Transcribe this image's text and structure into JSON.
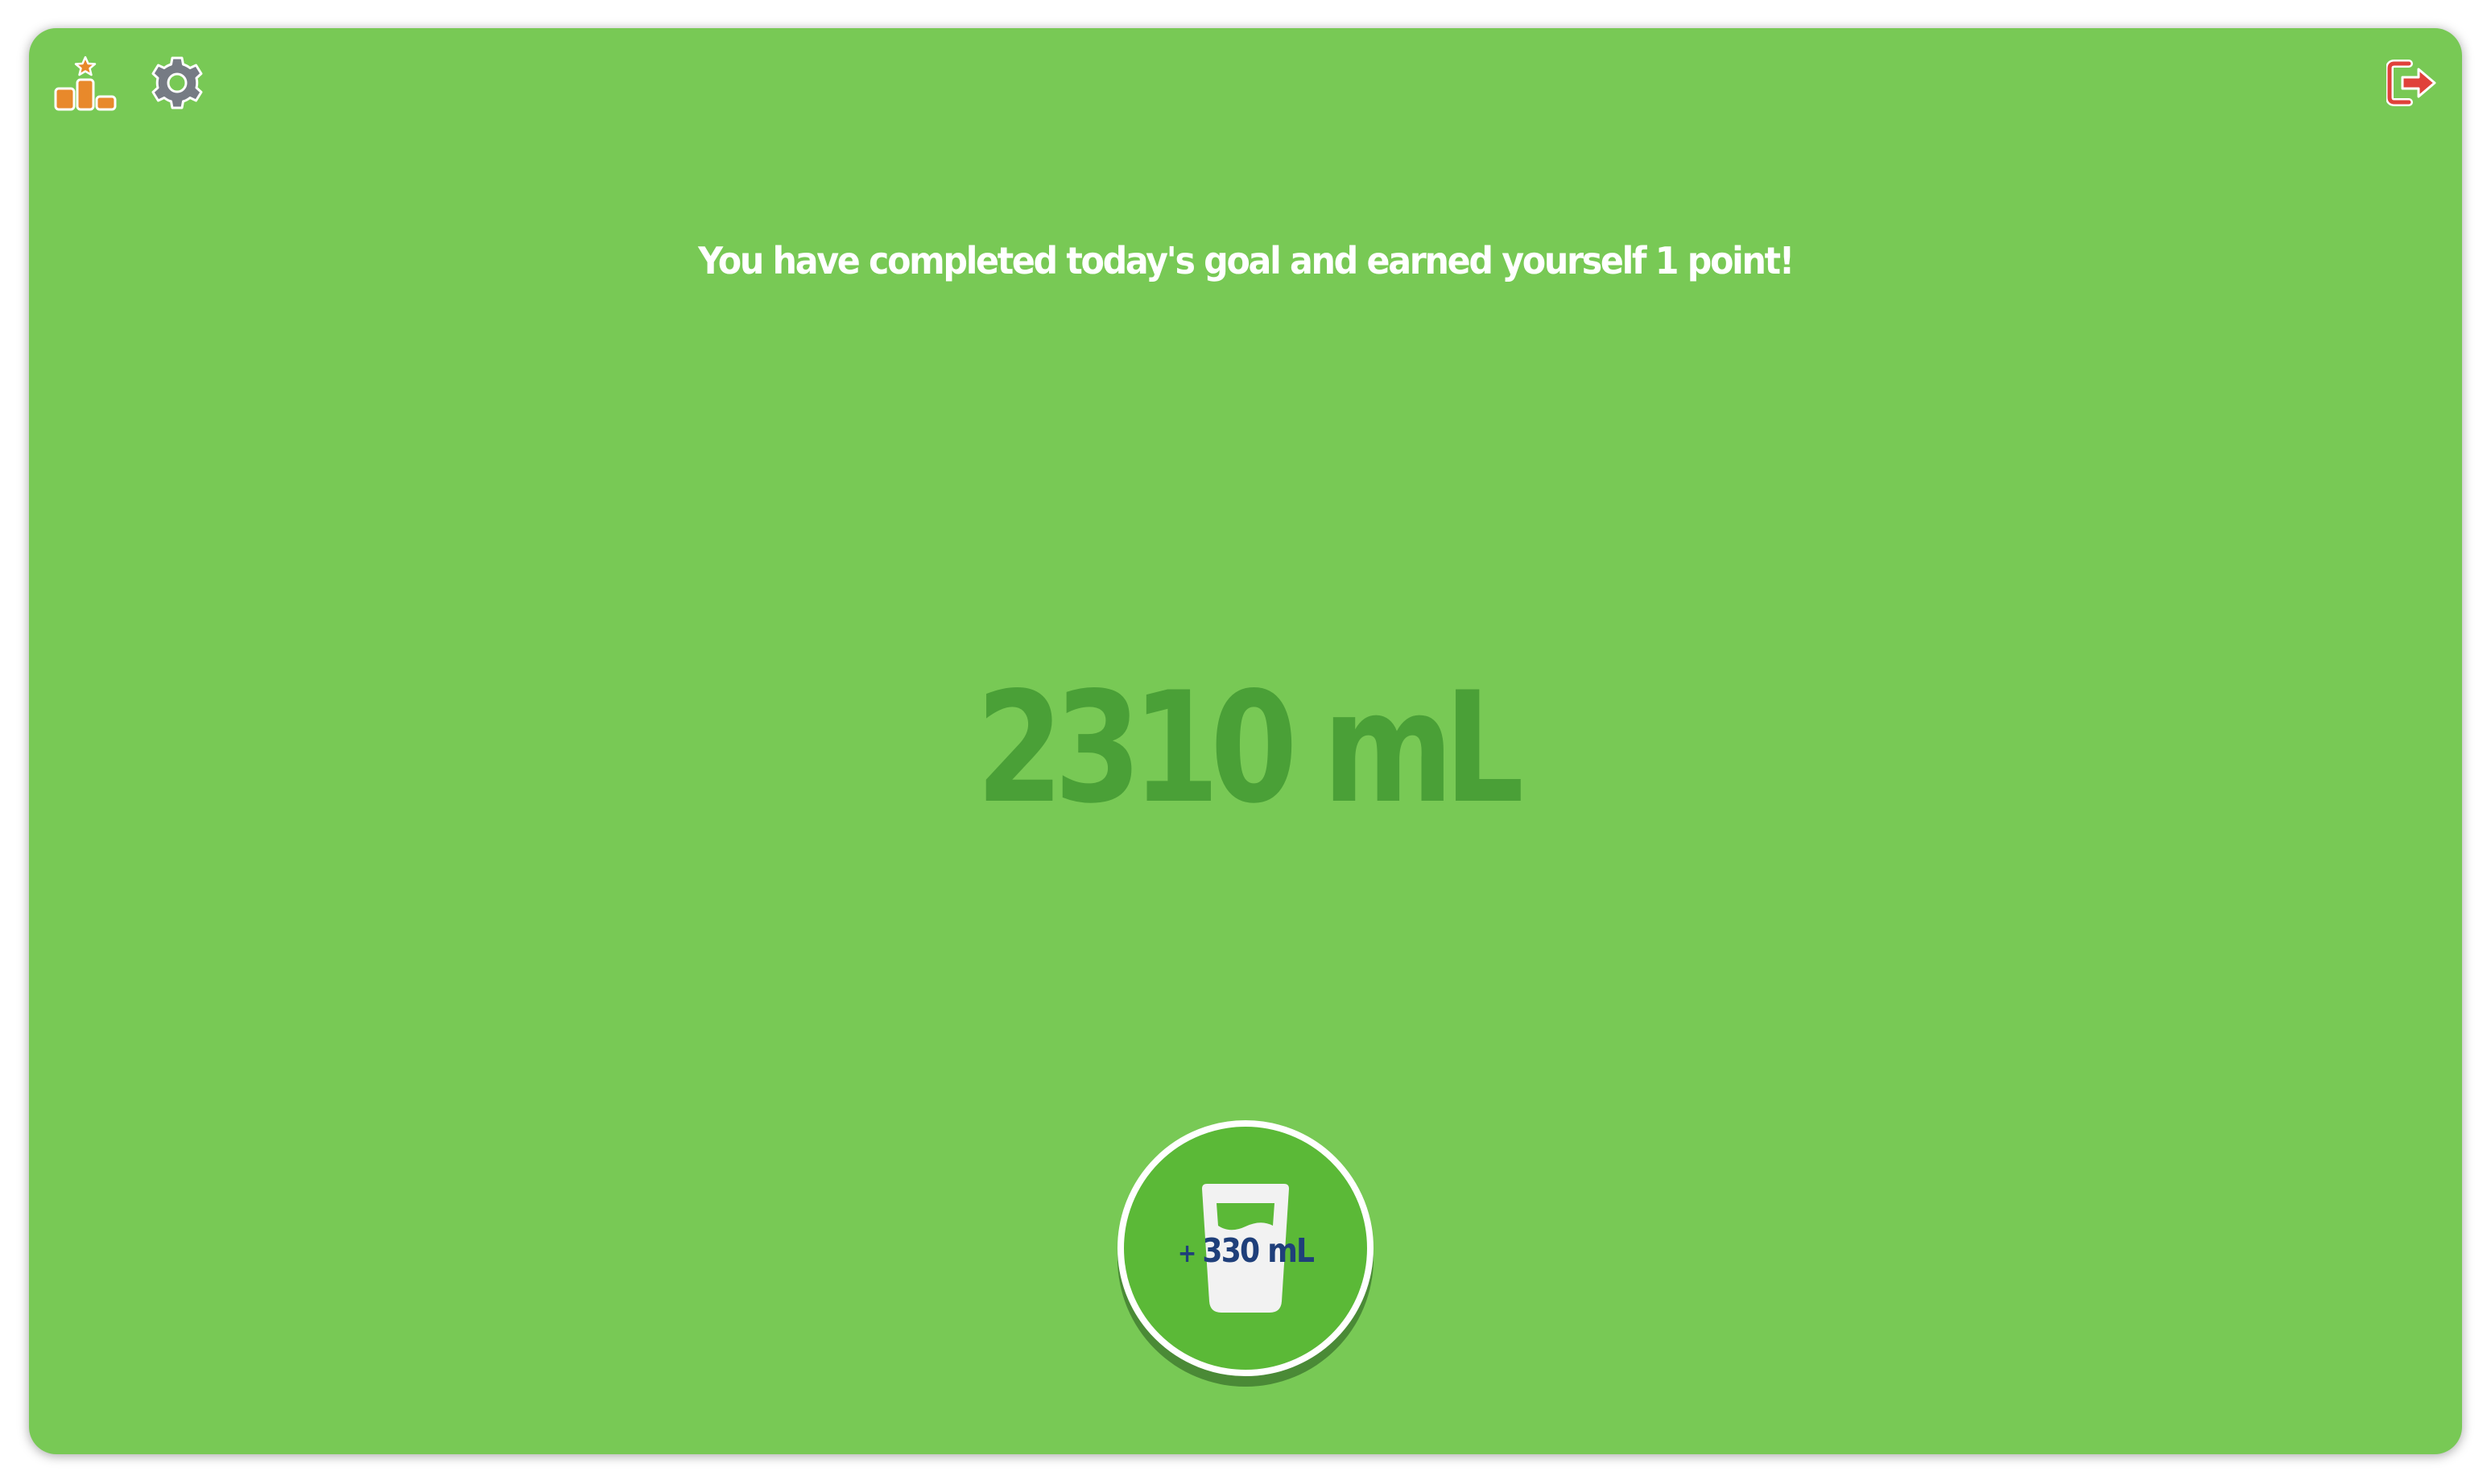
{
  "message": "You have completed today's goal and earned yourself 1 point!",
  "total": {
    "amount": "2310 mL"
  },
  "drink_button": {
    "plus": "+",
    "amount": "330 mL"
  },
  "icons": {
    "leaderboard": "podium-star-icon",
    "settings": "gear-icon",
    "logout": "logout-icon",
    "drink": "water-glass-icon"
  },
  "colors": {
    "background": "#78c955",
    "total_text": "#4aa037",
    "drink_button": "#5bb937",
    "drink_label": "#1f3f7a",
    "leaderboard_icon": "#e8892b",
    "logout_icon": "#e0413a"
  }
}
